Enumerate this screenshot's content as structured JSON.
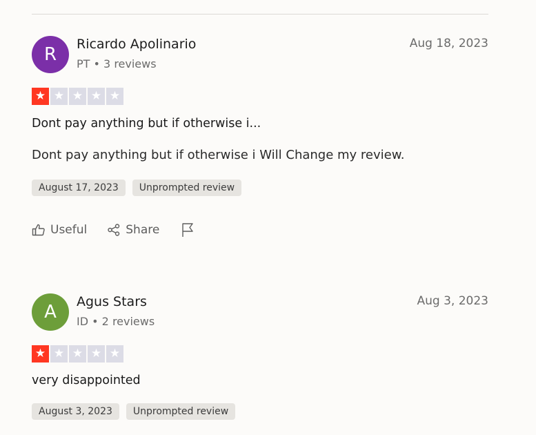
{
  "colors": {
    "star_filled": "#ff3722",
    "star_empty": "#dcdce6"
  },
  "reviews": [
    {
      "avatar_letter": "R",
      "avatar_color": "#7b2fa8",
      "name": "Ricardo Apolinario",
      "country": "PT",
      "separator": "•",
      "reviews_count": "3 reviews",
      "date": "Aug 18, 2023",
      "rating": 1,
      "title": "Dont pay anything but if otherwise i...",
      "text": "Dont pay anything but if otherwise i Will Change my review.",
      "experience_date": "August 17, 2023",
      "source_tag": "Unprompted review",
      "actions": {
        "useful": "Useful",
        "share": "Share"
      }
    },
    {
      "avatar_letter": "A",
      "avatar_color": "#6d9e3a",
      "name": "Agus Stars",
      "country": "ID",
      "separator": "•",
      "reviews_count": "2 reviews",
      "date": "Aug 3, 2023",
      "rating": 1,
      "title": "very disappointed",
      "experience_date": "August 3, 2023",
      "source_tag": "Unprompted review"
    }
  ]
}
